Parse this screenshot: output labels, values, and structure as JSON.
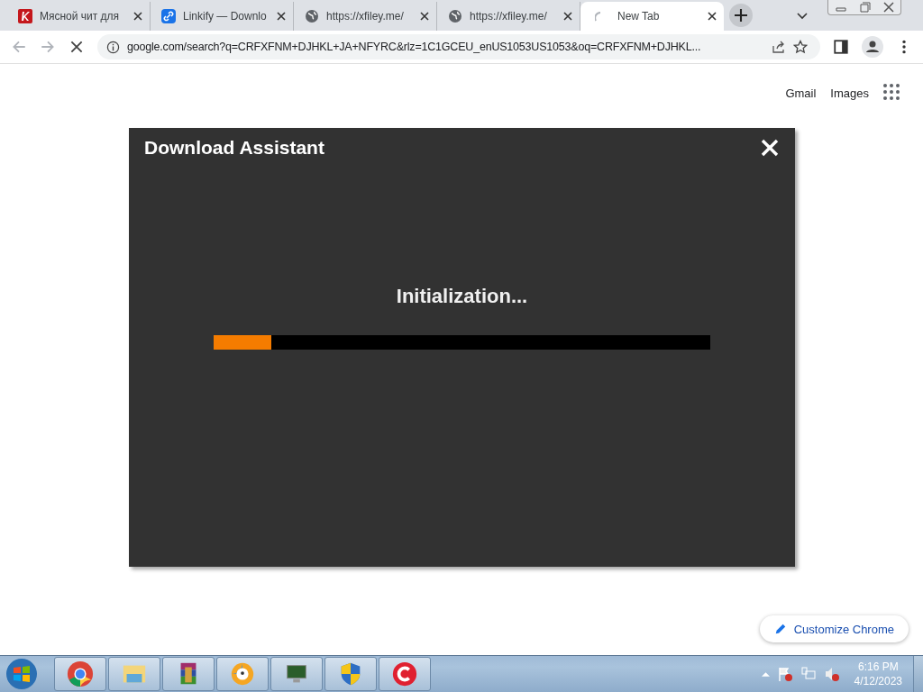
{
  "tabs": [
    {
      "title": "Мясной чит для",
      "selected": false
    },
    {
      "title": "Linkify — Downlo",
      "selected": false
    },
    {
      "title": "https://xfiley.me/",
      "selected": false
    },
    {
      "title": "https://xfiley.me/",
      "selected": false
    },
    {
      "title": "New Tab",
      "selected": true
    }
  ],
  "address_bar": {
    "url": "google.com/search?q=CRFXFNM+DJHKL+JA+NFYRC&rlz=1C1GCEU_enUS1053US1053&oq=CRFXFNM+DJHKL..."
  },
  "header_links": [
    "Gmail",
    "Images"
  ],
  "dialog": {
    "title": "Download Assistant",
    "status": "Initialization...",
    "level": 0.116
  },
  "customize_button": "Customize Chrome",
  "taskbar": {
    "time": "6:16 PM",
    "date": "4/12/2023"
  }
}
